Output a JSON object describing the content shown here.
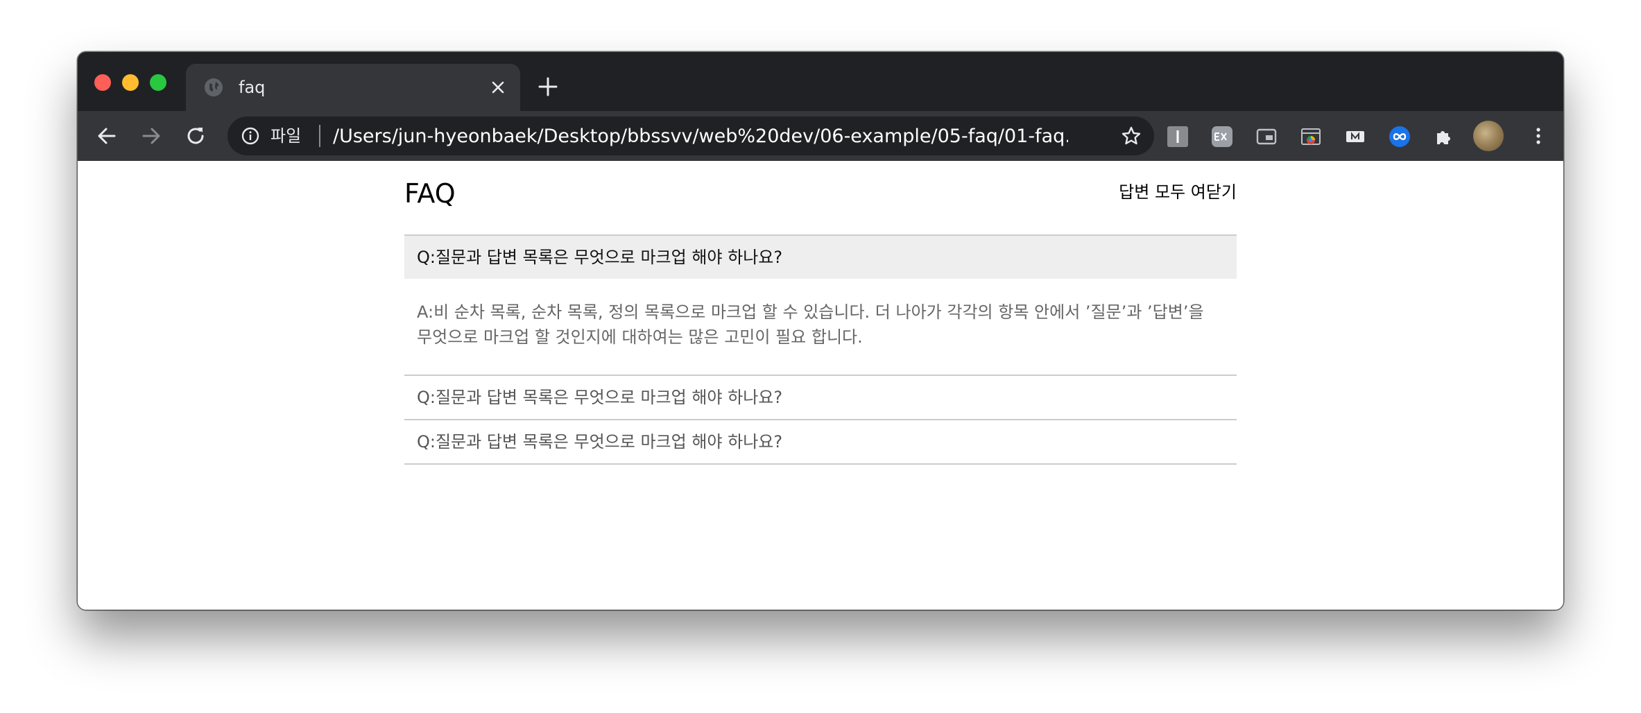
{
  "browser": {
    "tab": {
      "title": "faq"
    },
    "omnibox": {
      "scheme_label": "파일",
      "url": "/Users/jun-hyeonbaek/Desktop/bbssvv/web%20dev/06-example/05-faq/01-faq...."
    },
    "extensions": [
      "ext-i-icon",
      "ext-ex-icon",
      "ext-pip-icon",
      "ext-screenshot-icon",
      "ext-note-icon",
      "ext-link-icon",
      "extensions-puzzle-icon"
    ]
  },
  "page": {
    "title": "FAQ",
    "toggle_all_label": "답변 모두 여닫기",
    "faq": [
      {
        "question": "Q:질문과 답변 목록은 무엇으로 마크업 해야 하나요?",
        "answer": "A:비 순차 목록, 순차 목록, 정의 목록으로 마크업 할 수 있습니다. 더 나아가 각각의 항목 안에서 ’질문’과 ’답변’을 무엇으로 마크업 할 것인지에 대하여는 많은 고민이 필요 합니다.",
        "open": true
      },
      {
        "question": "Q:질문과 답변 목록은 무엇으로 마크업 해야 하나요?",
        "open": false
      },
      {
        "question": "Q:질문과 답변 목록은 무엇으로 마크업 해야 하나요?",
        "open": false
      }
    ]
  },
  "colors": {
    "tabstrip_bg": "#202124",
    "toolbar_bg": "#35363a",
    "open_question_bg": "#eeeeee",
    "divider": "#cccccc"
  }
}
